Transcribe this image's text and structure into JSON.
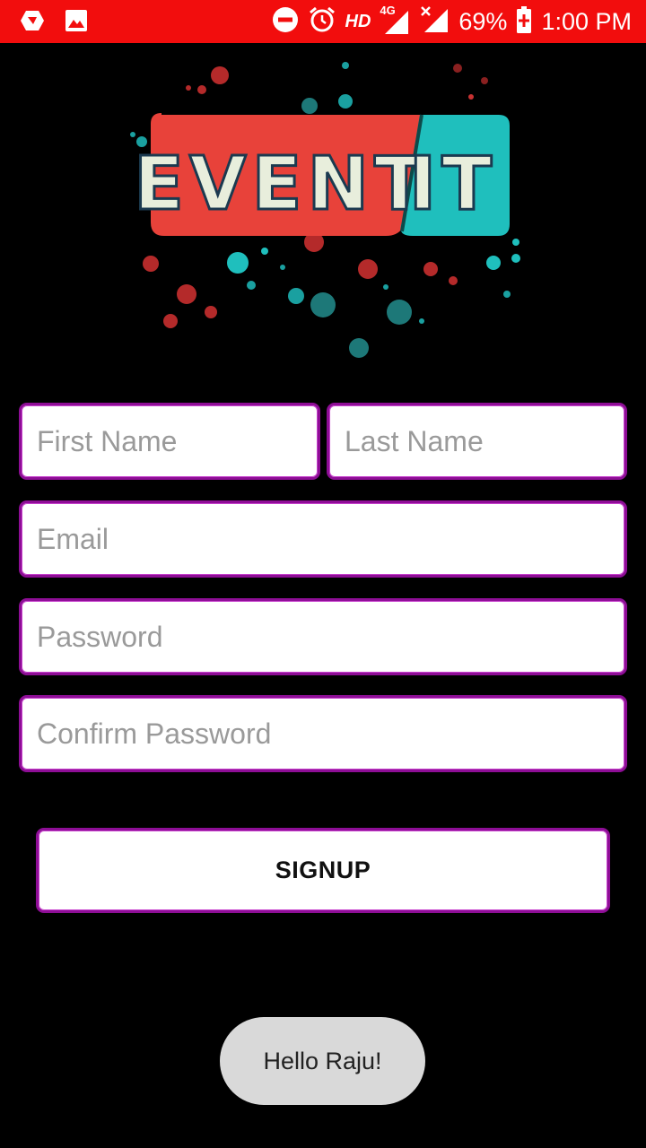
{
  "status_bar": {
    "background": "#f20d0d",
    "left_icons": [
      "notification-app-icon",
      "image-icon"
    ],
    "right_icons": [
      "do-not-disturb-icon",
      "alarm-icon",
      "hd-icon",
      "signal-4g-icon",
      "signal-no-sim-icon",
      "battery-charging-icon"
    ],
    "hd_label": "HD",
    "network_label": "4G",
    "battery_percent": "69%",
    "time": "1:00 PM"
  },
  "logo": {
    "word_left": "EVENT",
    "word_right": "IT",
    "colors": {
      "red": "#e8423a",
      "teal": "#1fbfbd"
    }
  },
  "form": {
    "first_name": {
      "placeholder": "First Name",
      "value": ""
    },
    "last_name": {
      "placeholder": "Last Name",
      "value": ""
    },
    "email": {
      "placeholder": "Email",
      "value": ""
    },
    "password": {
      "placeholder": "Password",
      "value": ""
    },
    "confirm_password": {
      "placeholder": "Confirm Password",
      "value": ""
    },
    "border_color": "#8e0e96",
    "signup_label": "SIGNUP"
  },
  "toast": {
    "message": "Hello Raju!"
  }
}
